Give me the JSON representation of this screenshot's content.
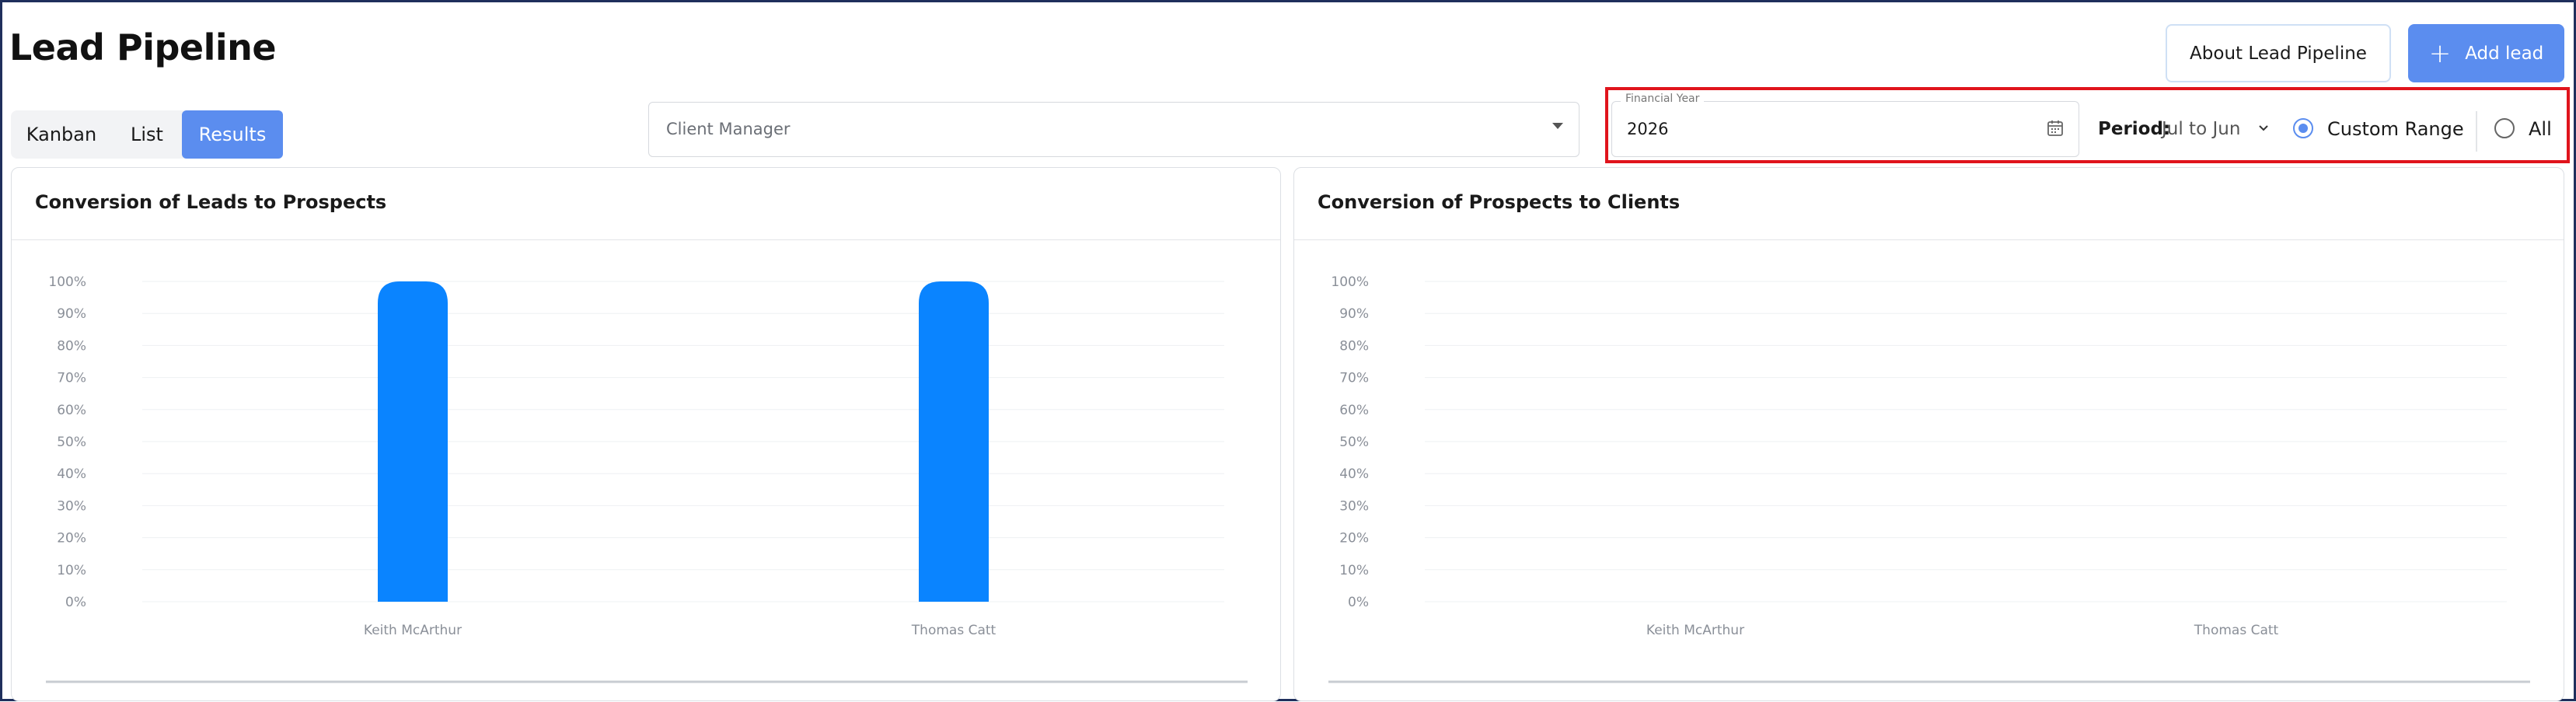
{
  "header": {
    "title": "Lead Pipeline",
    "about_label": "About Lead Pipeline",
    "add_label": "Add lead",
    "add_icon": "plus-icon",
    "accent_color": "#5b8def"
  },
  "tabs": [
    {
      "label": "Kanban",
      "active": false
    },
    {
      "label": "List",
      "active": false
    },
    {
      "label": "Results",
      "active": true
    }
  ],
  "filters": {
    "client_manager_placeholder": "Client Manager",
    "financial_year_label": "Financial Year",
    "financial_year_value": "2026",
    "period_label": "Period:",
    "period_value": "Jul to Jun",
    "radio_custom_label": "Custom Range",
    "radio_all_label": "All",
    "selected_radio": "Custom Range"
  },
  "charts": {
    "left_title": "Conversion of Leads to Prospects",
    "right_title": "Conversion of Prospects to Clients"
  },
  "chart_data": [
    {
      "type": "bar",
      "title": "Conversion of Leads to Prospects",
      "categories": [
        "Keith McArthur",
        "Thomas Catt"
      ],
      "values": [
        100,
        100
      ],
      "y_ticks": [
        "0%",
        "10%",
        "20%",
        "30%",
        "40%",
        "50%",
        "60%",
        "70%",
        "80%",
        "90%",
        "100%"
      ],
      "ylim": [
        0,
        100
      ],
      "grid": true,
      "bar_color": "#0a84ff"
    },
    {
      "type": "bar",
      "title": "Conversion of Prospects to Clients",
      "categories": [
        "Keith McArthur",
        "Thomas Catt"
      ],
      "values": [
        0,
        0
      ],
      "y_ticks": [
        "0%",
        "10%",
        "20%",
        "30%",
        "40%",
        "50%",
        "60%",
        "70%",
        "80%",
        "90%",
        "100%"
      ],
      "ylim": [
        0,
        100
      ],
      "grid": true,
      "bar_color": "#0a84ff"
    }
  ]
}
